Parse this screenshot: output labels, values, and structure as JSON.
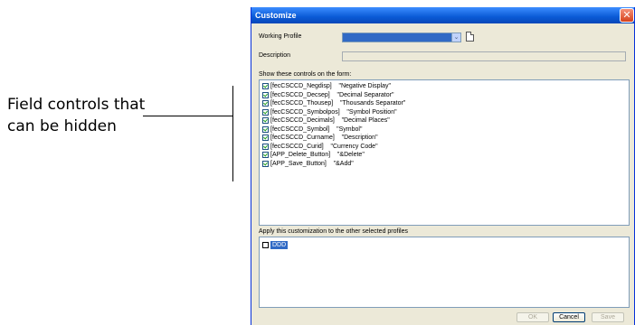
{
  "annotation": {
    "text": "Field controls that\ncan be hidden"
  },
  "dialog": {
    "title": "Customize",
    "close_glyph": "✕",
    "working_profile_label": "Working Profile",
    "description_label": "Description",
    "controls_header": "Show these controls on the form:",
    "controls": [
      {
        "text": "[fecCSCCD_Negdisp]    \"Negative Display\"",
        "checked": true
      },
      {
        "text": "[fecCSCCD_Decsep]    \"Decimal Separator\"",
        "checked": true
      },
      {
        "text": "[fecCSCCD_Thousep]    \"Thousands Separator\"",
        "checked": true
      },
      {
        "text": "[fecCSCCD_Symbolpos]    \"Symbol Position\"",
        "checked": true
      },
      {
        "text": "[fecCSCCD_Decimals]    \"Decimal Places\"",
        "checked": true
      },
      {
        "text": "[fecCSCCD_Symbol]    \"Symbol\"",
        "checked": true
      },
      {
        "text": "[fecCSCCD_Curname]    \"Description\"",
        "checked": true
      },
      {
        "text": "[fecCSCCD_Curid]    \"Currency Code\"",
        "checked": true
      },
      {
        "text": "[APP_Delete_Button]    \"&Delete\"",
        "checked": true
      },
      {
        "text": "[APP_Save_Button]    \"&Add\"",
        "checked": true
      }
    ],
    "apply_header": "Apply this customization to the other selected profiles",
    "profiles": [
      {
        "name": "DDD",
        "checked": false
      }
    ],
    "buttons": {
      "ok": "OK",
      "cancel": "Cancel",
      "save": "Save"
    },
    "dropdown_glyph": "⌄",
    "colors": {
      "titlebar": "#0a5ad6",
      "selection": "#316ac5",
      "dialog_bg": "#ece9d8"
    }
  }
}
